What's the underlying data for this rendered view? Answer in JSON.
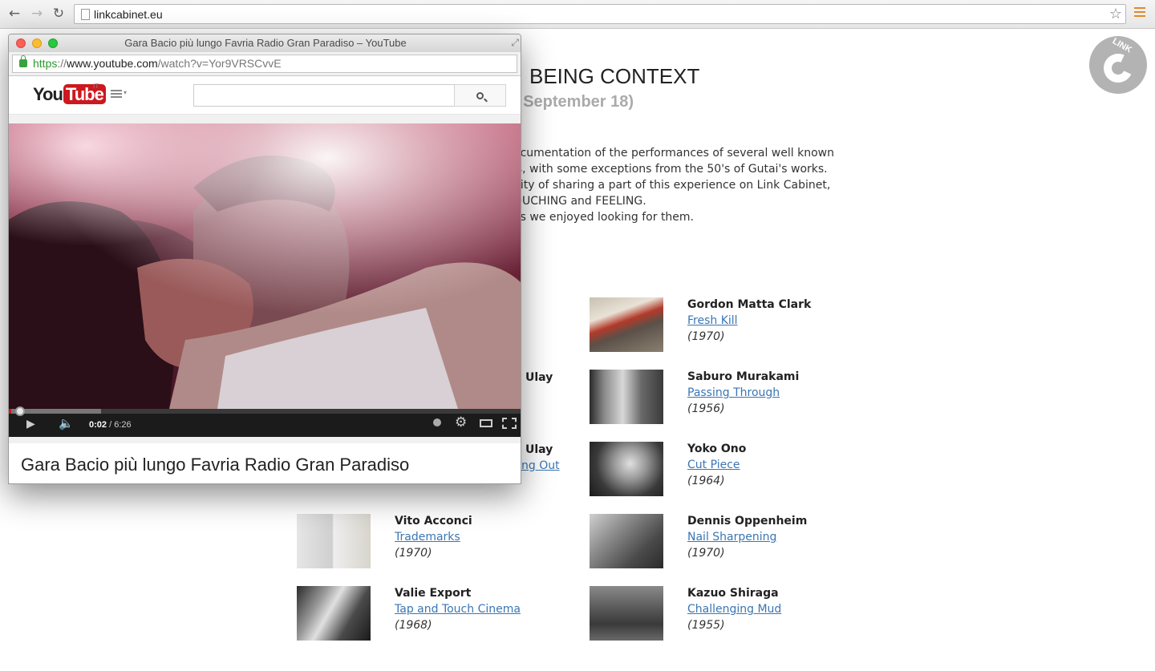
{
  "browser": {
    "url": "linkcabinet.eu",
    "back_icon": "back-arrow-icon",
    "forward_icon": "forward-arrow-icon",
    "reload_icon": "reload-icon"
  },
  "site": {
    "logo_text": "LINK",
    "title": "BEING CONTEXT",
    "subtitle": "- September 18)",
    "paragraph": [
      "ocumentation of the performances of several well known",
      "'s, with some exceptions from the 50's of Gutai's works.",
      "nity of sharing a part of this experience on Link Cabinet,",
      "OUCHING and FEELING.",
      "as we enjoyed looking for them."
    ],
    "partial_left": [
      {
        "text": "Ulay",
        "kind": "artist"
      },
      {
        "text": "Ulay",
        "kind": "artist"
      },
      {
        "text": "ng Out",
        "kind": "link"
      }
    ],
    "works_right": [
      {
        "artist": "Gordon Matta Clark",
        "piece": "Fresh Kill",
        "year": "(1970)"
      },
      {
        "artist": "Saburo Murakami",
        "piece": "Passing Through",
        "year": "(1956)"
      },
      {
        "artist": "Yoko Ono",
        "piece": "Cut Piece",
        "year": "(1964)"
      },
      {
        "artist": "Dennis Oppenheim",
        "piece": "Nail Sharpening",
        "year": "(1970)"
      },
      {
        "artist": "Kazuo Shiraga",
        "piece": "Challenging Mud",
        "year": "(1955)"
      }
    ],
    "works_left": [
      {
        "artist": "Vito Acconci",
        "piece": "Trademarks",
        "year": "(1970)"
      },
      {
        "artist": "Valie Export",
        "piece": "Tap and Touch Cinema",
        "year": "(1968)"
      }
    ]
  },
  "popup": {
    "window_title": "Gara Bacio più lungo Favria Radio Gran Paradiso – YouTube",
    "url_scheme": "https",
    "url_sep": "://",
    "url_host": "www.youtube.com",
    "url_path": "/watch?v=Yor9VRSCvvE",
    "youtube_logo_you": "You",
    "youtube_logo_tube": "Tube",
    "youtube_region": "IT",
    "search_value": "",
    "player": {
      "current_time": "0:02",
      "separator": " / ",
      "duration": "6:26",
      "progress_fraction": 0.005,
      "loaded_fraction": 0.18
    },
    "video_title": "Gara Bacio più lungo Favria Radio Gran Paradiso"
  }
}
